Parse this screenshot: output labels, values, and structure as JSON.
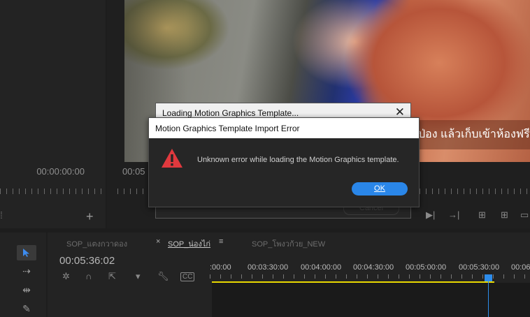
{
  "source_monitor": {
    "timecode": "00:00:00:00",
    "add_label": "+"
  },
  "program_monitor": {
    "timecode": "00:05",
    "subtitle": "ป่อง แล้วเก็บเข้าห้องฟรี"
  },
  "loading_dialog": {
    "title": "Loading Motion Graphics Template...",
    "close_glyph": "✕",
    "cancel_label": "Cancel"
  },
  "error_dialog": {
    "title": "Motion Graphics Template Import Error",
    "message": "Unknown error while loading the Motion Graphics template.",
    "ok_label": "OK",
    "icon": "warning-icon",
    "icon_color": "#e0393e",
    "button_color": "#2a86e8"
  },
  "timeline": {
    "tabs": [
      {
        "label": "SOP_แตงกวาดอง"
      },
      {
        "label": "SOP_น่องไก่"
      },
      {
        "label": "SOP_โพงวก้วย_NEW"
      }
    ],
    "active_tab_close": "×",
    "active_tab_menu": "≡",
    "timecode": "00:05:36:02",
    "ruler_labels": [
      ":00:00",
      "00:03:30:00",
      "00:04:00:00",
      "00:04:30:00",
      "00:05:00:00",
      "00:05:30:00",
      "00:06"
    ],
    "work_area_color": "#e8d800",
    "playhead_color": "#2d8ceb"
  },
  "icons": {
    "selection_tool": "selection-arrow-icon",
    "track_select": "track-select-icon",
    "ripple_edit": "ripple-edit-icon",
    "razor": "razor-icon",
    "snap": "snap-icon",
    "linked": "linked-selection-icon",
    "marker": "marker-icon",
    "wrench": "wrench-icon",
    "captions": "captions-icon"
  }
}
